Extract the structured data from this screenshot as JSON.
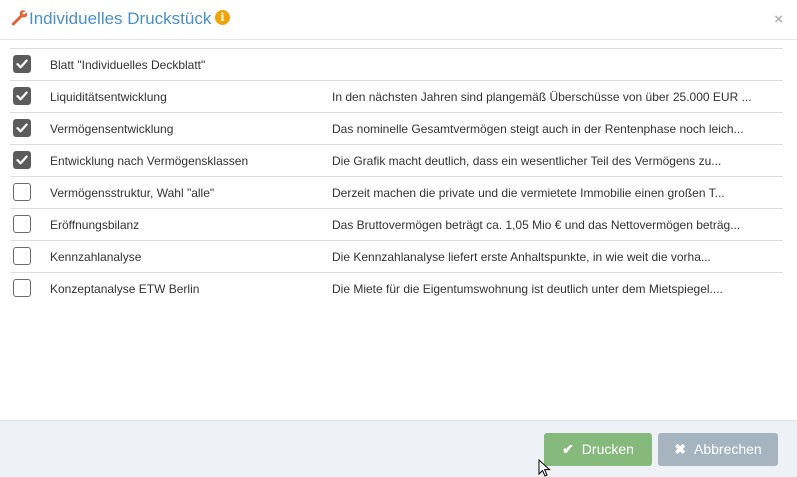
{
  "dialog": {
    "title": "Individuelles Druckstück",
    "close_label": "×",
    "icons": {
      "title_icon": "wrench-icon",
      "info_icon": "info-icon",
      "info_glyph": "i"
    },
    "colors": {
      "title": "#4a90c8",
      "info": "#f0a30a",
      "print_button": "#86b97c",
      "cancel_button": "#a6b4c0"
    }
  },
  "items": [
    {
      "label": "Blatt \"Individuelles Deckblatt\"",
      "description": "",
      "checked": true
    },
    {
      "label": "Liquiditätsentwicklung",
      "description": "In den nächsten Jahren sind plangemäß Überschüsse von über 25.000 EUR ...",
      "checked": true
    },
    {
      "label": "Vermögensentwicklung",
      "description": "Das nominelle Gesamtvermögen steigt auch in der Rentenphase noch leich...",
      "checked": true
    },
    {
      "label": "Entwicklung nach Vermögensklassen",
      "description": "Die Grafik macht deutlich, dass ein wesentlicher Teil des Vermögens zu...",
      "checked": true
    },
    {
      "label": "Vermögensstruktur, Wahl \"alle\"",
      "description": "Derzeit machen die private und die vermietete Immobilie einen großen T...",
      "checked": false
    },
    {
      "label": "Eröffnungsbilanz",
      "description": "Das Bruttovermögen beträgt ca. 1,05 Mio € und das Nettovermögen beträg...",
      "checked": false
    },
    {
      "label": "Kennzahlanalyse",
      "description": "Die Kennzahlanalyse liefert erste Anhaltspunkte, in wie weit die vorha...",
      "checked": false
    },
    {
      "label": "Konzeptanalyse ETW Berlin",
      "description": "Die Miete für die Eigentumswohnung ist deutlich unter dem Mietspiegel....",
      "checked": false
    }
  ],
  "footer": {
    "print_label": "Drucken",
    "cancel_label": "Abbrechen",
    "print_icon": "check-icon",
    "cancel_icon": "x-icon"
  }
}
